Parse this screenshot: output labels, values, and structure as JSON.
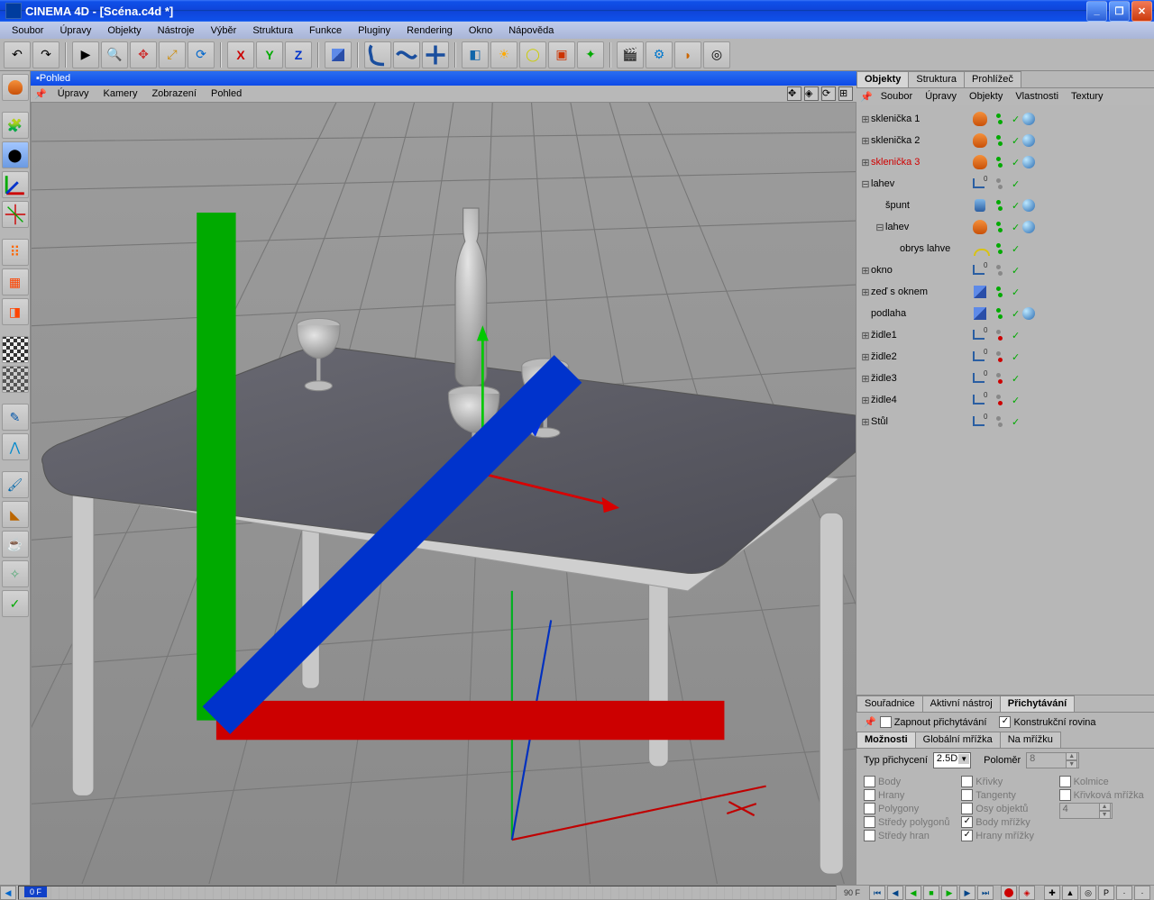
{
  "titlebar": {
    "text": "CINEMA 4D - [Scéna.c4d *]"
  },
  "mainMenu": [
    "Soubor",
    "Úpravy",
    "Objekty",
    "Nástroje",
    "Výběr",
    "Struktura",
    "Funkce",
    "Pluginy",
    "Rendering",
    "Okno",
    "Nápověda"
  ],
  "viewport": {
    "title": "Pohled",
    "menu": [
      "Úpravy",
      "Kamery",
      "Zobrazení",
      "Pohled"
    ]
  },
  "objectPanel": {
    "tabs": [
      "Objekty",
      "Struktura",
      "Prohlížeč"
    ],
    "activeTab": 0,
    "menu": [
      "Soubor",
      "Úpravy",
      "Objekty",
      "Vlastnosti",
      "Textury"
    ],
    "items": [
      {
        "indent": 0,
        "tog": "⊞",
        "name": "sklenička 1",
        "icon": "vase",
        "vis": "gg",
        "tex": true
      },
      {
        "indent": 0,
        "tog": "⊞",
        "name": "sklenička 2",
        "icon": "vase",
        "vis": "gg",
        "tex": true
      },
      {
        "indent": 0,
        "tog": "⊞",
        "name": "sklenička 3",
        "icon": "vase",
        "vis": "gg",
        "tex": true,
        "selected": true
      },
      {
        "indent": 0,
        "tog": "⊟",
        "name": "lahev",
        "icon": "null",
        "vis": "xx",
        "tex": false
      },
      {
        "indent": 1,
        "tog": "",
        "name": "špunt",
        "icon": "cyl",
        "vis": "gg",
        "tex": true
      },
      {
        "indent": 1,
        "tog": "⊟",
        "name": "lahev",
        "icon": "vase",
        "vis": "gg",
        "tex": true
      },
      {
        "indent": 2,
        "tog": "",
        "name": "obrys lahve",
        "icon": "spline",
        "vis": "gg",
        "tex": false
      },
      {
        "indent": 0,
        "tog": "⊞",
        "name": "okno",
        "icon": "null",
        "vis": "xx",
        "tex": false
      },
      {
        "indent": 0,
        "tog": "⊞",
        "name": "zeď s oknem",
        "icon": "cube",
        "vis": "gg",
        "tex": false
      },
      {
        "indent": 0,
        "tog": "",
        "name": "podlaha",
        "icon": "cube",
        "vis": "gg",
        "tex": true
      },
      {
        "indent": 0,
        "tog": "⊞",
        "name": "židle1",
        "icon": "null",
        "vis": "xr",
        "tex": false
      },
      {
        "indent": 0,
        "tog": "⊞",
        "name": "židle2",
        "icon": "null",
        "vis": "xr",
        "tex": false
      },
      {
        "indent": 0,
        "tog": "⊞",
        "name": "židle3",
        "icon": "null",
        "vis": "xr",
        "tex": false
      },
      {
        "indent": 0,
        "tog": "⊞",
        "name": "židle4",
        "icon": "null",
        "vis": "xr",
        "tex": false
      },
      {
        "indent": 0,
        "tog": "⊞",
        "name": "Stůl",
        "icon": "null",
        "vis": "xx",
        "tex": false
      }
    ]
  },
  "bottomRight": {
    "tabs": [
      "Souřadnice",
      "Aktivní nástroj",
      "Přichytávání"
    ],
    "activeTab": 2,
    "enableLabel": "Zapnout přichytávání",
    "enableChecked": false,
    "planeLabel": "Konstrukční rovina",
    "planeChecked": true,
    "subtabs": [
      "Možnosti",
      "Globální mřížka",
      "Na mřížku"
    ],
    "activeSubtab": 0,
    "typLabel": "Typ přichycení",
    "typValue": "2.5D",
    "polomerLabel": "Poloměr",
    "polomerValue": "8",
    "col1": [
      "Body",
      "Hrany",
      "Polygony",
      "Středy polygonů",
      "Středy hran"
    ],
    "col2": [
      "Křivky",
      "Tangenty",
      "Osy objektů",
      "Body mřížky",
      "Hrany mřížky"
    ],
    "col2checked": [
      false,
      false,
      false,
      true,
      true
    ],
    "col3": [
      "Kolmice",
      "Křivková mřížka"
    ],
    "col3value": "4"
  },
  "timeline": {
    "frame": "0 F",
    "frameR": "90 F"
  }
}
